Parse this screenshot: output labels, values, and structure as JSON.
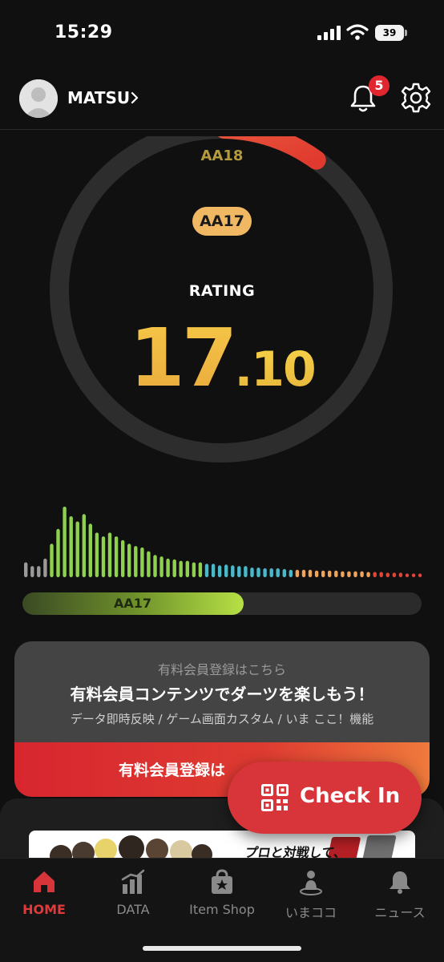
{
  "status_bar": {
    "time": "15:29",
    "battery": "39"
  },
  "header": {
    "user_name": "MATSU",
    "notification_count": "5"
  },
  "rating": {
    "next_class": "AA18",
    "current_class": "AA17",
    "label": "RATING",
    "value_int": "17",
    "value_dec": ".10",
    "progress_to_next_fraction": 0.1
  },
  "histogram": {
    "values": [
      20,
      15,
      15,
      25,
      45,
      65,
      95,
      82,
      75,
      85,
      72,
      60,
      55,
      60,
      55,
      50,
      45,
      42,
      40,
      35,
      30,
      28,
      25,
      24,
      22,
      22,
      20,
      20,
      18,
      18,
      16,
      17,
      16,
      15,
      15,
      13,
      13,
      12,
      12,
      12,
      11,
      10,
      10,
      10,
      10,
      9,
      9,
      9,
      9,
      8,
      8,
      8,
      8,
      7,
      7,
      7,
      6,
      6,
      6,
      5,
      5,
      5
    ],
    "colors": {
      "low": "#9a9a9a",
      "green": "#8fd14f",
      "cyan": "#49b8c9",
      "orange": "#f0a35a",
      "red": "#e0453a"
    }
  },
  "class_progress": {
    "label": "AA17",
    "fraction": 0.555
  },
  "promo": {
    "subtitle": "有料会員登録はこちら",
    "title": "有料会員コンテンツでダーツを楽しもう！",
    "description": "データ即時反映 / ゲーム画面カスタム / いま ここ！機能",
    "button_label": "有料会員登録は"
  },
  "banner": {
    "text": "プロと対戦して、"
  },
  "checkin": {
    "label": "Check In"
  },
  "tabs": [
    {
      "label": "HOME",
      "icon": "home-icon",
      "active": true
    },
    {
      "label": "DATA",
      "icon": "data-chart-icon",
      "active": false
    },
    {
      "label": "Item Shop",
      "icon": "item-shop-icon",
      "active": false
    },
    {
      "label": "いまココ",
      "icon": "location-person-icon",
      "active": false
    },
    {
      "label": "ニュース",
      "icon": "news-bell-icon",
      "active": false
    }
  ],
  "theme": {
    "accent": "#d8353a",
    "gold": "#f2c94c",
    "background": "#101010"
  }
}
